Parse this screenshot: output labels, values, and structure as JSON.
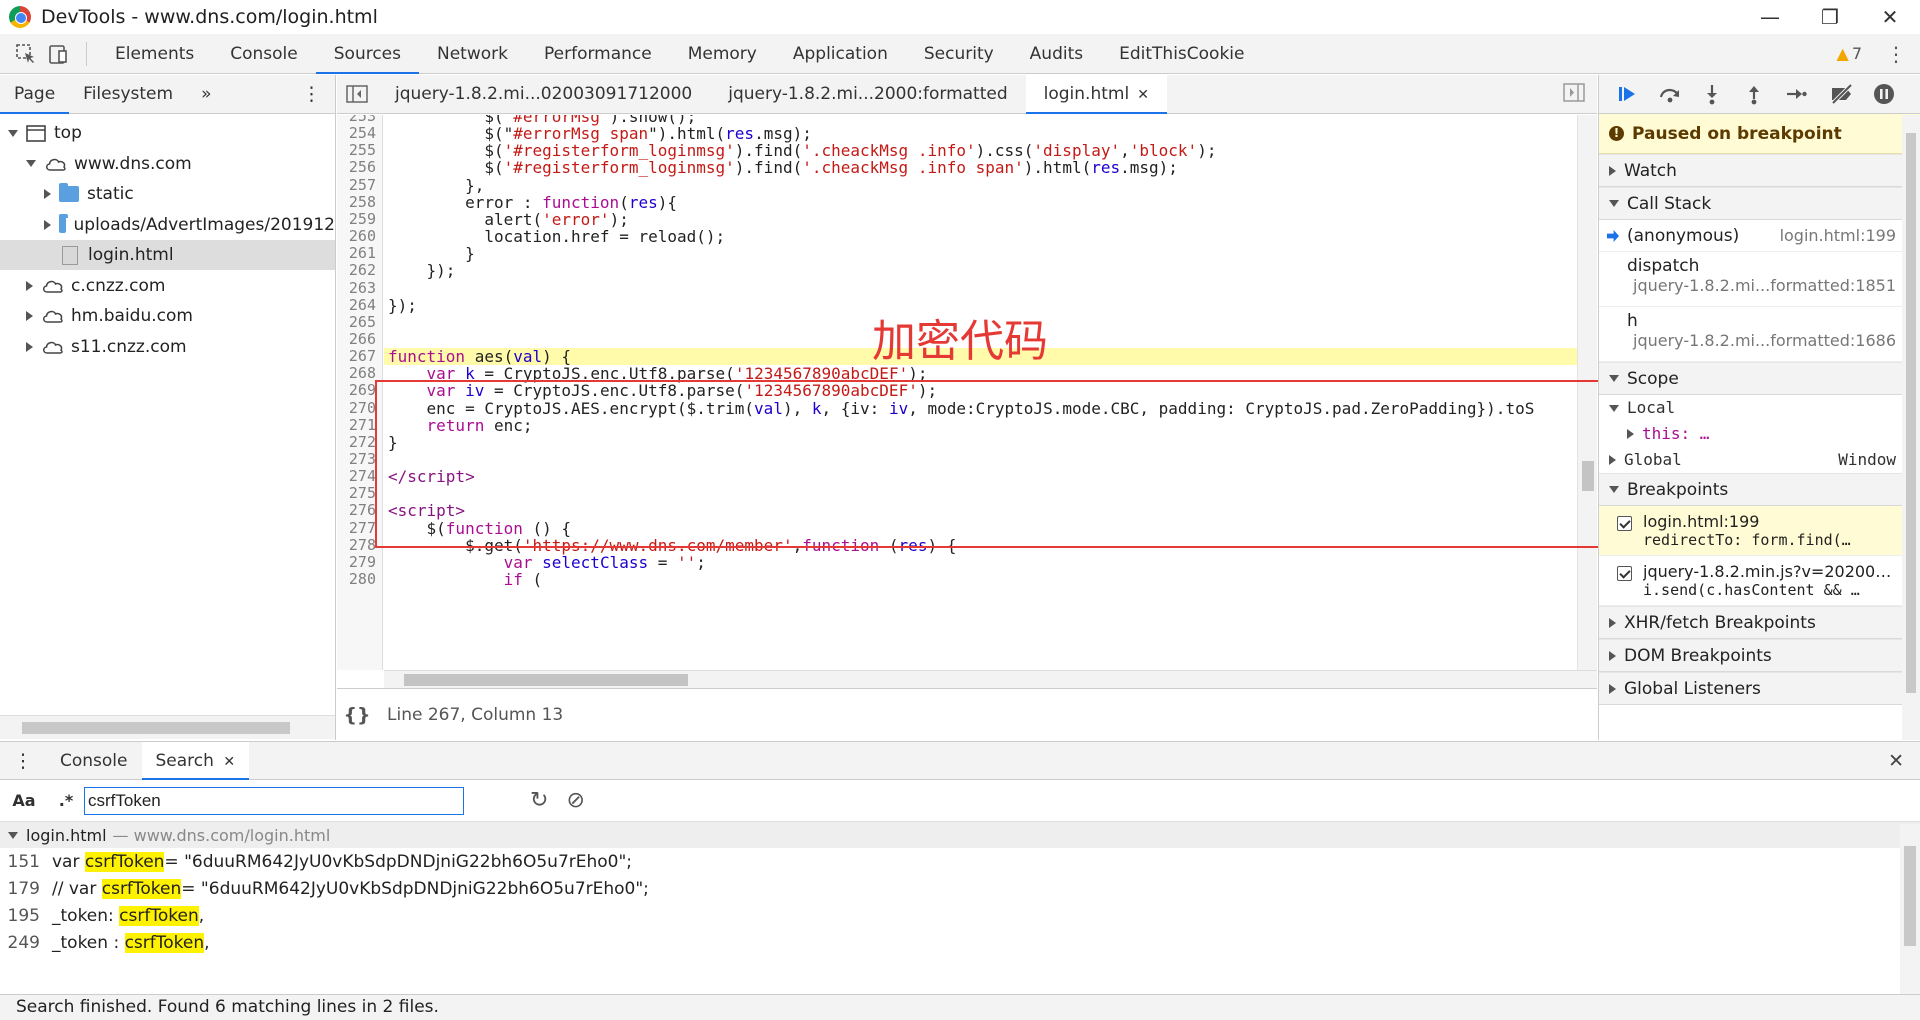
{
  "window": {
    "title": "DevTools - www.dns.com/login.html",
    "minimize_glyph": "—",
    "maximize_glyph": "❐",
    "close_glyph": "✕"
  },
  "toolbar": {
    "tabs": [
      "Elements",
      "Console",
      "Sources",
      "Network",
      "Performance",
      "Memory",
      "Application",
      "Security",
      "Audits",
      "EditThisCookie"
    ],
    "active_tab": "Sources",
    "warning_count": "7",
    "warning_glyph": "▲",
    "more_glyph": "⋮"
  },
  "navigator": {
    "tabs": [
      "Page",
      "Filesystem"
    ],
    "more_glyph": "»",
    "kebab_glyph": "⋮",
    "tree": [
      {
        "label": "top",
        "depth": 0,
        "kind": "frame",
        "expanded": true
      },
      {
        "label": "www.dns.com",
        "depth": 1,
        "kind": "cloud",
        "expanded": true
      },
      {
        "label": "static",
        "depth": 2,
        "kind": "folder",
        "expanded": false
      },
      {
        "label": "uploads/AdvertImages/201912",
        "depth": 2,
        "kind": "folder",
        "expanded": false
      },
      {
        "label": "login.html",
        "depth": 3,
        "kind": "file",
        "selected": true
      },
      {
        "label": "c.cnzz.com",
        "depth": 1,
        "kind": "cloud",
        "expanded": false
      },
      {
        "label": "hm.baidu.com",
        "depth": 1,
        "kind": "cloud",
        "expanded": false
      },
      {
        "label": "s11.cnzz.com",
        "depth": 1,
        "kind": "cloud",
        "expanded": false
      }
    ]
  },
  "editor": {
    "tabs": [
      {
        "label": "jquery-1.8.2.mi...02003091712000",
        "active": false
      },
      {
        "label": "jquery-1.8.2.mi...2000:formatted",
        "active": false
      },
      {
        "label": "login.html",
        "active": true,
        "closable": true
      }
    ],
    "close_glyph": "✕",
    "status": "Line 267, Column 13",
    "pretty_glyph": "{}",
    "annotation": "加密代码",
    "highlight_line": 267,
    "lines": [
      {
        "n": "253",
        "html": "          $(\"<span class='str'>#errorMsg</span>\").show();"
      },
      {
        "n": "254",
        "html": "          $(\"<span class='str'>#errorMsg span</span>\").html(<span class='vr'>res</span>.msg);"
      },
      {
        "n": "255",
        "html": "          $(<span class='str'>'#registerform_loginmsg'</span>).find(<span class='str'>'.cheackMsg .info'</span>).css(<span class='str'>'display'</span>,<span class='str'>'block'</span>);"
      },
      {
        "n": "256",
        "html": "          $(<span class='str'>'#registerform_loginmsg'</span>).find(<span class='str'>'.cheackMsg .info span'</span>).html(<span class='vr'>res</span>.msg);"
      },
      {
        "n": "257",
        "html": "        },"
      },
      {
        "n": "258",
        "html": "        error : <span class='kw'>function</span>(<span class='vr'>res</span>){"
      },
      {
        "n": "259",
        "html": "          alert(<span class='str'>'error'</span>);"
      },
      {
        "n": "260",
        "html": "          location.href = reload();"
      },
      {
        "n": "261",
        "html": "        }"
      },
      {
        "n": "262",
        "html": "    });"
      },
      {
        "n": "263",
        "html": ""
      },
      {
        "n": "264",
        "html": "});"
      },
      {
        "n": "265",
        "html": ""
      },
      {
        "n": "266",
        "html": ""
      },
      {
        "n": "267",
        "html": "<span class='kw'>function</span> aes(<span class='vr'>val</span>) {"
      },
      {
        "n": "268",
        "html": "    <span class='kw'>var</span> <span class='vr'>k</span> = CryptoJS.enc.Utf8.parse(<span class='str'>'1234567890abcDEF'</span>);"
      },
      {
        "n": "269",
        "html": "    <span class='kw'>var</span> <span class='vr'>iv</span> = CryptoJS.enc.Utf8.parse(<span class='str'>'1234567890abcDEF'</span>);"
      },
      {
        "n": "270",
        "html": "    enc = CryptoJS.AES.encrypt($.trim(<span class='vr'>val</span>), <span class='vr'>k</span>, {iv: <span class='vr'>iv</span>, mode:CryptoJS.mode.CBC, padding: CryptoJS.pad.ZeroPadding}).toS"
      },
      {
        "n": "271",
        "html": "    <span class='kw'>return</span> enc;"
      },
      {
        "n": "272",
        "html": "}"
      },
      {
        "n": "273",
        "html": ""
      },
      {
        "n": "274",
        "html": "<span class='tag'>&lt;/script&gt;</span>"
      },
      {
        "n": "275",
        "html": ""
      },
      {
        "n": "276",
        "html": "<span class='tag'>&lt;script&gt;</span>"
      },
      {
        "n": "277",
        "html": "    $(<span class='kw'>function</span> () {"
      },
      {
        "n": "278",
        "html": "        $.get(<span class='str'>'https://www.dns.com/member'</span>,<span class='kw'>function</span> (<span class='vr'>res</span>) {"
      },
      {
        "n": "279",
        "html": "            <span class='kw'>var</span> <span class='vr'>selectClass</span> = <span class='str'>''</span>;"
      },
      {
        "n": "280",
        "html": "            <span class='kw'>if</span> ("
      }
    ]
  },
  "debugger": {
    "paused_text": "Paused on breakpoint",
    "sections": {
      "watch": "Watch",
      "call_stack": "Call Stack",
      "scope": "Scope",
      "breakpoints": "Breakpoints",
      "xhr": "XHR/fetch Breakpoints",
      "dom": "DOM Breakpoints",
      "global_listeners": "Global Listeners"
    },
    "frames": [
      {
        "fn": "(anonymous)",
        "loc": "login.html:199",
        "current": true
      },
      {
        "fn": "dispatch",
        "loc": "jquery-1.8.2.mi...formatted:1851"
      },
      {
        "fn": "h",
        "loc": "jquery-1.8.2.mi...formatted:1686"
      }
    ],
    "scope": {
      "local": "Local",
      "this_label": "this: …",
      "global": "Global",
      "global_value": "Window"
    },
    "breakpoints": [
      {
        "file": "login.html:199",
        "code": "redirectTo: form.find(…",
        "highlight": true
      },
      {
        "file": "jquery-1.8.2.min.js?v=20200…",
        "code": "i.send(c.hasContent && …",
        "highlight": false
      }
    ]
  },
  "drawer": {
    "tabs": [
      "Console",
      "Search"
    ],
    "active_tab": "Search",
    "close_glyph": "✕",
    "kebab_glyph": "⋮",
    "case_label": "Aa",
    "regex_label": ".*",
    "search_value": "csrfToken",
    "refresh_glyph": "↻",
    "clear_glyph": "⊘",
    "result_file": "login.html",
    "result_url": "— www.dns.com/login.html",
    "results": [
      {
        "line": "151",
        "before": "var ",
        "match": "csrfToken",
        "after": " = \"6duuRM642JyU0vKbSdpDNDjniG22bh6O5u7rEho0\";"
      },
      {
        "line": "179",
        "before": "// var ",
        "match": "csrfToken",
        "after": " = \"6duuRM642JyU0vKbSdpDNDjniG22bh6O5u7rEho0\";"
      },
      {
        "line": "195",
        "before": "_token: ",
        "match": "csrfToken",
        "after": ","
      },
      {
        "line": "249",
        "before": "_token : ",
        "match": "csrfToken",
        "after": ","
      }
    ],
    "status": "Search finished.  Found 6 matching lines in 2 files."
  }
}
